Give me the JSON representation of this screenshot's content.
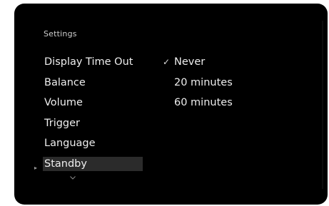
{
  "header": {
    "title": "Settings"
  },
  "menu": {
    "items": [
      {
        "label": "Display Time Out"
      },
      {
        "label": "Balance"
      },
      {
        "label": "Volume"
      },
      {
        "label": "Trigger"
      },
      {
        "label": "Language"
      },
      {
        "label": "Standby"
      }
    ],
    "selected_index": 5
  },
  "options": {
    "items": [
      {
        "label": "Never",
        "checked": true
      },
      {
        "label": "20 minutes",
        "checked": false
      },
      {
        "label": "60 minutes",
        "checked": false
      }
    ]
  },
  "icons": {
    "check": "check-icon",
    "selection_marker": "caret-right-icon",
    "more": "chevron-down-icon"
  },
  "colors": {
    "background": "#000000",
    "highlight": "#2b2b2b",
    "text": "#eeeeee"
  }
}
